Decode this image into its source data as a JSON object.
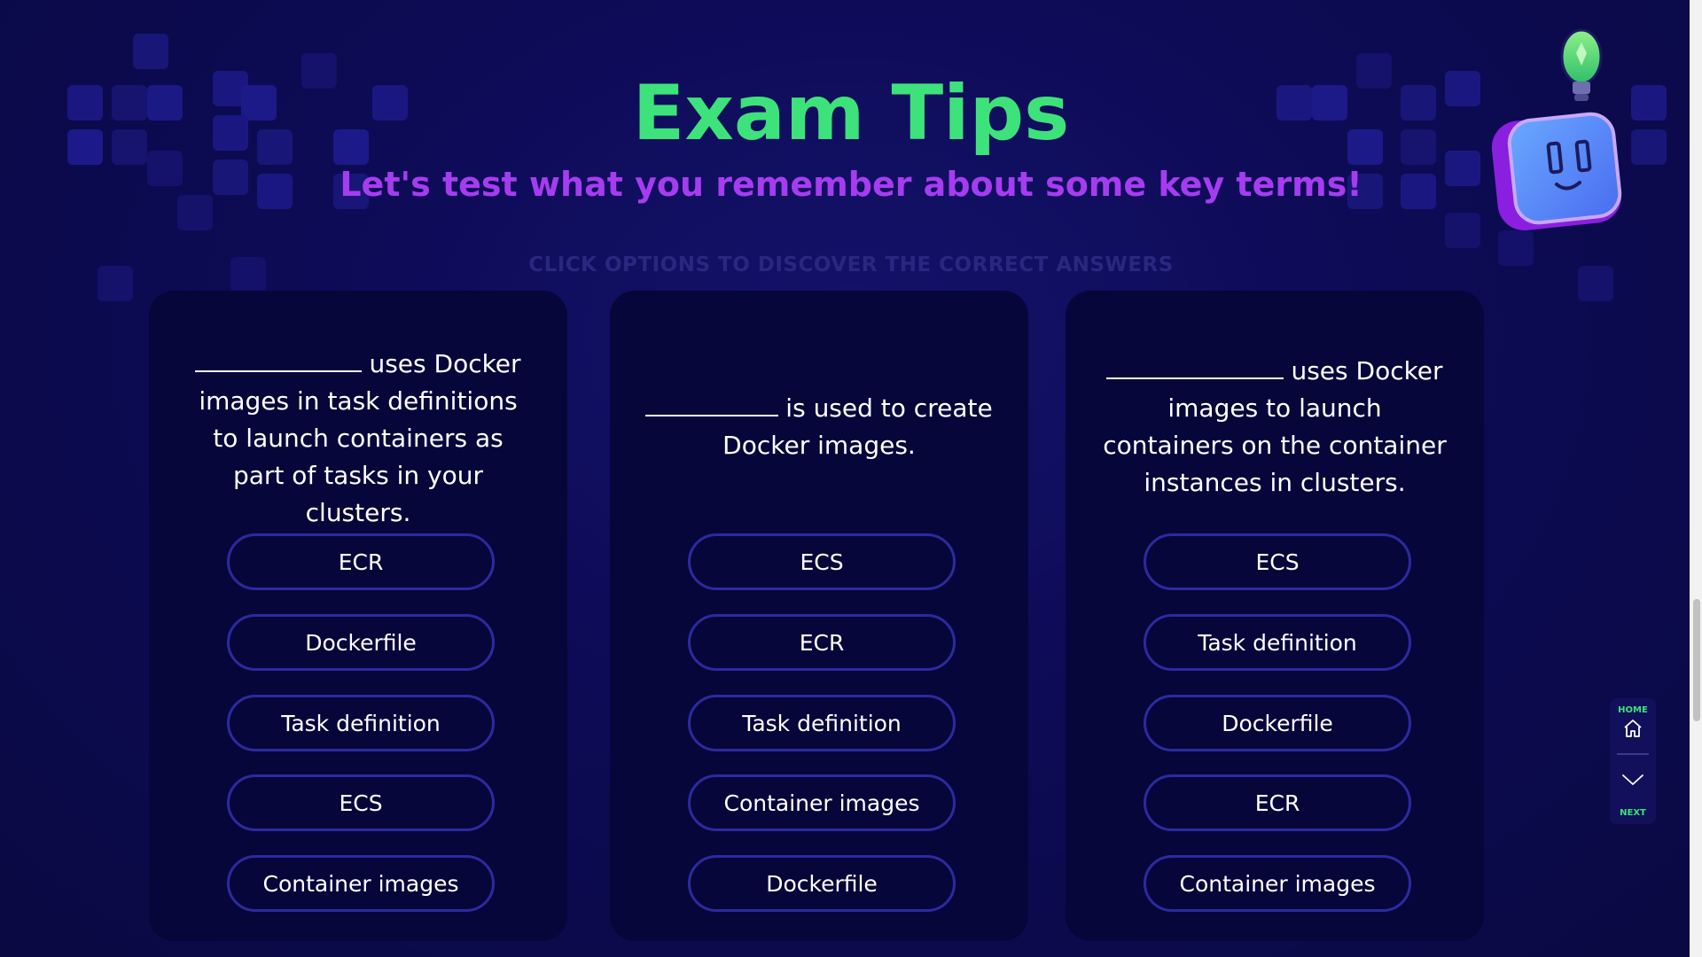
{
  "header": {
    "title": "Exam Tips",
    "subtitle": "Let's test what you remember about some key terms!",
    "instructions": "CLICK OPTIONS TO DISCOVER THE CORRECT ANSWERS"
  },
  "cards": [
    {
      "question_text": "uses Docker images in task definitions to launch containers as part of tasks in your clusters.",
      "options": [
        "ECR",
        "Dockerfile",
        "Task definition",
        "ECS",
        "Container images"
      ]
    },
    {
      "question_text": "is used to create Docker images.",
      "options": [
        "ECS",
        "ECR",
        "Task definition",
        "Container images",
        "Dockerfile"
      ]
    },
    {
      "question_text": "uses Docker images to launch containers on the container instances in clusters.",
      "options": [
        "ECS",
        "Task definition",
        "Dockerfile",
        "ECR",
        "Container images"
      ]
    }
  ],
  "nav": {
    "home_label": "HOME",
    "next_label": "NEXT",
    "home_icon": "home-icon",
    "next_icon": "chevron-down-icon"
  },
  "colors": {
    "title": "#3ee27a",
    "subtitle": "#a63cf0",
    "card_bg": "#07063a",
    "option_border": "#2c2aa0",
    "page_bg": "#0d0b55"
  },
  "mascot_icon": "robot-lightbulb-icon"
}
